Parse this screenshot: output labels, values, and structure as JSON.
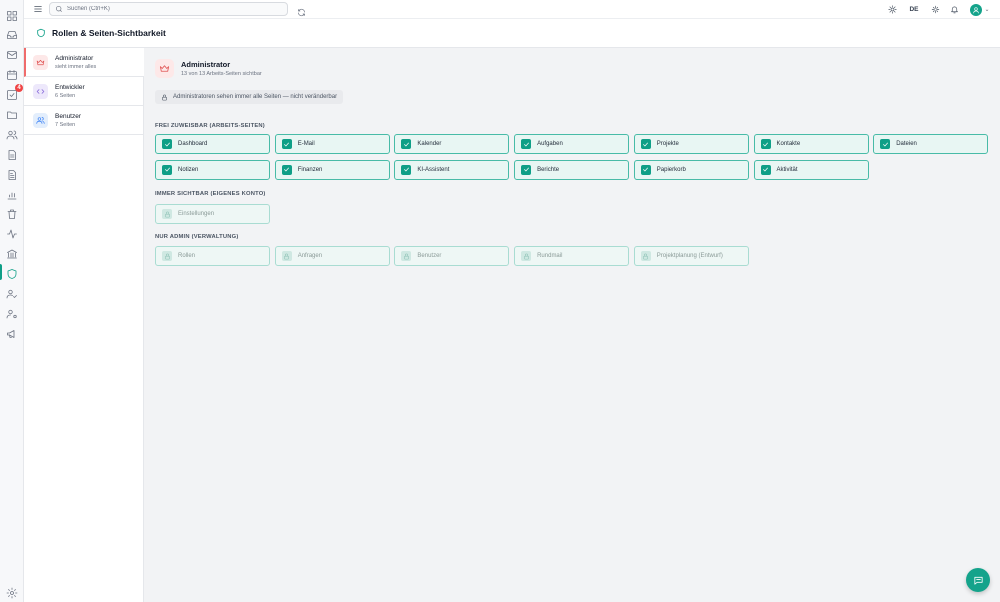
{
  "topbar": {
    "search_placeholder": "Suchen (Ctrl+K)",
    "language": "DE"
  },
  "sidebar": {
    "icons": [
      "grid-icon",
      "inbox-icon",
      "mail-icon",
      "calendar-icon",
      "tasks-icon",
      "folder-icon",
      "users-icon",
      "document-icon",
      "document-text-icon",
      "chart-icon",
      "trash-icon",
      "activity-icon",
      "bank-icon",
      "shield-icon",
      "user-check-icon",
      "user-cog-icon",
      "megaphone-icon"
    ],
    "tasks_badge": "4",
    "active": "shield-icon"
  },
  "page": {
    "title": "Rollen & Seiten-Sichtbarkeit"
  },
  "roles": [
    {
      "name": "Administrator",
      "sub": "sieht immer alles"
    },
    {
      "name": "Entwickler",
      "sub": "6 Seiten"
    },
    {
      "name": "Benutzer",
      "sub": "7 Seiten"
    }
  ],
  "detail": {
    "name": "Administrator",
    "sub": "13 von 13 Arbeits-Seiten sichtbar",
    "info": "Administratoren sehen immer alle Seiten — nicht veränderbar"
  },
  "sections": {
    "free": "FREI ZUWEISBAR (ARBEITS-SEITEN)",
    "always": "IMMER SICHTBAR (EIGENES KONTO)",
    "admin": "NUR ADMIN (VERWALTUNG)"
  },
  "free_pages": [
    "Dashboard",
    "E-Mail",
    "Kalender",
    "Aufgaben",
    "Projekte",
    "Kontakte",
    "Dateien",
    "Notizen",
    "Finanzen",
    "KI-Assistent",
    "Berichte",
    "Papierkorb",
    "Aktivität"
  ],
  "always_pages": [
    "Einstellungen"
  ],
  "admin_pages": [
    "Rollen",
    "Anfragen",
    "Benutzer",
    "Rundmail",
    "Projektplanung (Entwurf)"
  ],
  "colors": {
    "accent": "#0f9f87",
    "admin_role": "#e05252",
    "dev_role": "#7c5cd6",
    "user_role": "#3b82f6",
    "badge": "#ef4444"
  }
}
